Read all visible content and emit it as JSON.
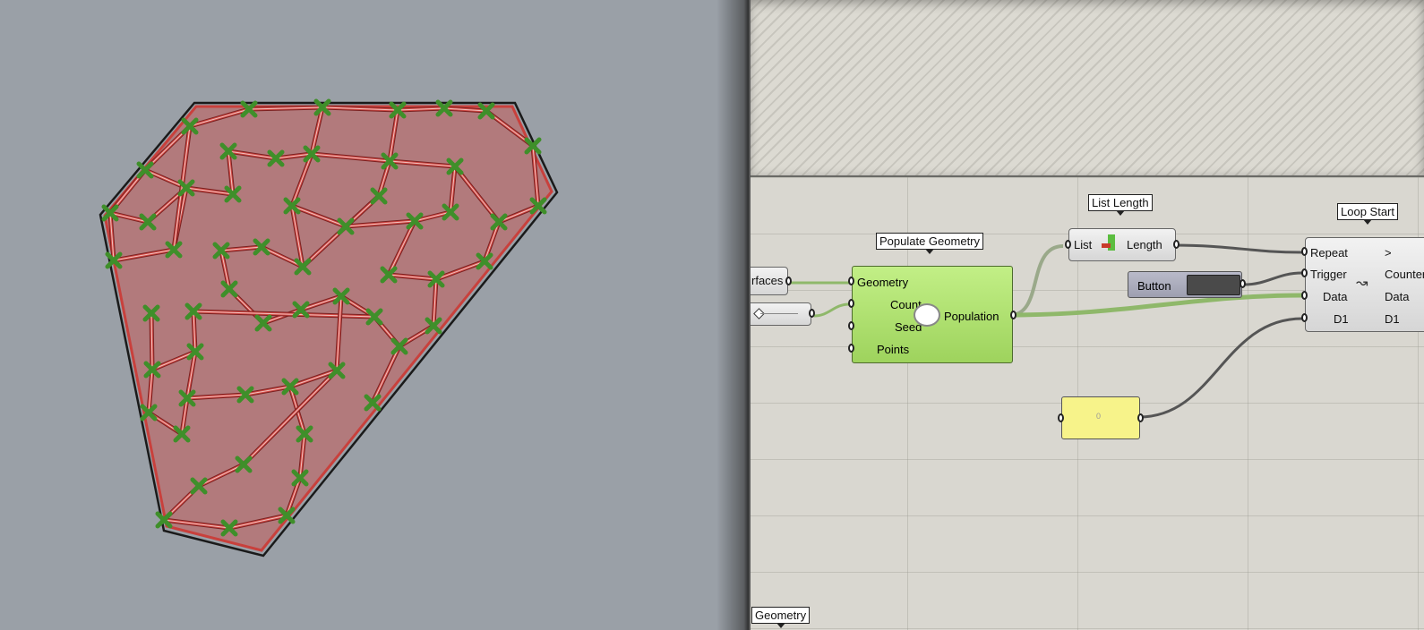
{
  "canvas": {
    "populate": {
      "label": "Populate Geometry",
      "inputs": [
        "Geometry",
        "Count",
        "Seed",
        "Points"
      ],
      "output": "Population"
    },
    "list_length": {
      "label": "List Length",
      "input": "List",
      "output": "Length"
    },
    "button": {
      "label": "Button"
    },
    "loop_start": {
      "label": "Loop Start",
      "inputs": [
        "Repeat",
        "Trigger",
        "Data",
        "D1"
      ],
      "outputs": [
        ">",
        "Counter",
        "Data",
        "D1"
      ]
    },
    "surfaces_param": {
      "label": "rfaces"
    },
    "panel": {
      "value": "0"
    },
    "bottom_tag": {
      "label": "Geometry"
    }
  },
  "colors": {
    "viewport_bg": "#9aa0a7",
    "region_fill": "#b27a7c",
    "region_stroke": "#c9403c",
    "point_marker": "#3f8f2a",
    "component_green": "#a8dd66",
    "panel_yellow": "#f7f38a"
  },
  "icons": [
    "cloud-icon",
    "list-length-icon",
    "loop-arrow-icon"
  ]
}
